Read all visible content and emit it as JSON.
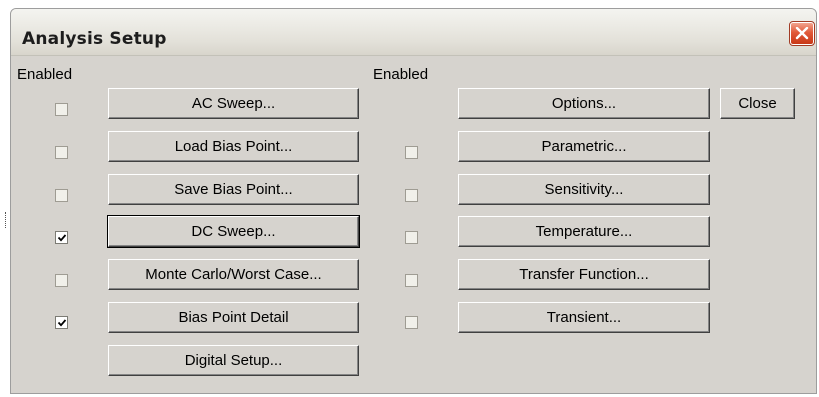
{
  "window": {
    "title": "Analysis Setup"
  },
  "column_headers": {
    "left": "Enabled",
    "right": "Enabled"
  },
  "left_analyses": [
    {
      "label": "AC Sweep...",
      "enabled": false,
      "checkbox_disabled": true
    },
    {
      "label": "Load Bias Point...",
      "enabled": false,
      "checkbox_disabled": true
    },
    {
      "label": "Save Bias Point...",
      "enabled": false,
      "checkbox_disabled": true
    },
    {
      "label": "DC Sweep...",
      "enabled": true,
      "checkbox_disabled": false,
      "focused": true
    },
    {
      "label": "Monte Carlo/Worst Case...",
      "enabled": false,
      "checkbox_disabled": true
    },
    {
      "label": "Bias Point Detail",
      "enabled": true,
      "checkbox_disabled": false
    },
    {
      "label": "Digital Setup...",
      "no_checkbox": true
    }
  ],
  "right_analyses": [
    {
      "label": "Options...",
      "no_checkbox": true
    },
    {
      "label": "Parametric...",
      "enabled": false,
      "checkbox_disabled": true
    },
    {
      "label": "Sensitivity...",
      "enabled": false,
      "checkbox_disabled": true
    },
    {
      "label": "Temperature...",
      "enabled": false,
      "checkbox_disabled": true
    },
    {
      "label": "Transfer Function...",
      "enabled": false,
      "checkbox_disabled": true
    },
    {
      "label": "Transient...",
      "enabled": false,
      "checkbox_disabled": true
    }
  ],
  "buttons": {
    "close_label": "Close"
  },
  "icons": {
    "window_close": "close-x-icon",
    "checkmark": "checkmark-icon"
  },
  "colors": {
    "dialog_face": "#d6d3ce",
    "close_button_red": "#e15a3a"
  }
}
